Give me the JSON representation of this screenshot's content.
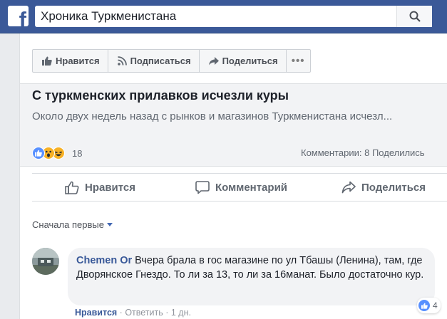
{
  "topbar": {
    "logo_letter": "f",
    "search_value": "Хроника Туркменистана",
    "brand_color": "#3b5998"
  },
  "page_actions": {
    "like": "Нравится",
    "follow": "Подписаться",
    "share": "Поделиться",
    "more": "•••"
  },
  "post": {
    "link_title": "С туркменских прилавков исчезли куры",
    "link_description": "Около двух недель назад с рынков и магазинов Туркменистана исчезл...",
    "reaction_count": "18",
    "stats_text": "Комментарии: 8  Поделились",
    "actions": {
      "like": "Нравится",
      "comment": "Комментарий",
      "share": "Поделиться"
    }
  },
  "comments": {
    "sort_label": "Сначала первые",
    "items": [
      {
        "author": "Chemen Or",
        "text": "Вчера брала в гос магазине по ул Тбашы (Ленина), там, где Дворянское Гнездо. То ли за 13, то ли за 16манат. Было достаточно кур.",
        "reaction_count": "4",
        "like_label": "Нравится",
        "reply_label": "Ответить",
        "time": "1 дн."
      }
    ]
  }
}
